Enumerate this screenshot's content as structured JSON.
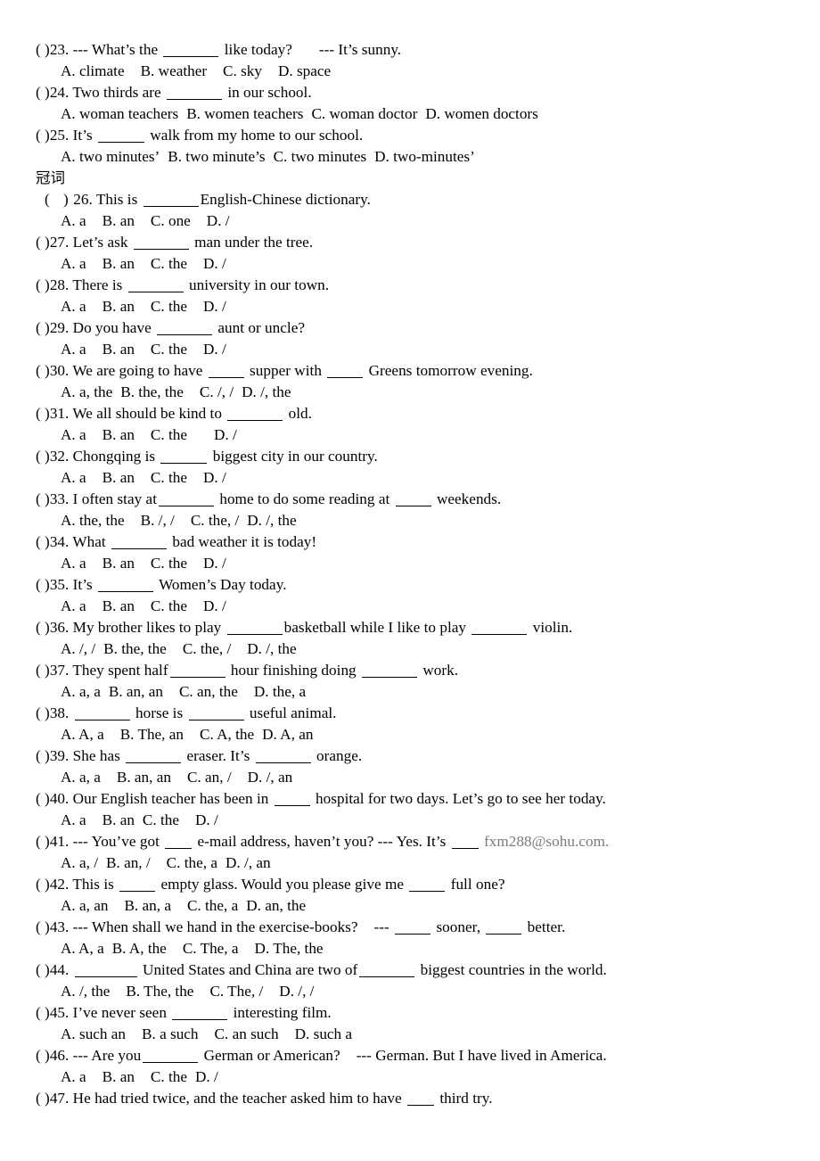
{
  "document": {
    "section_heading": "冠词",
    "questions": [
      {
        "number": "23",
        "marker": "(  )",
        "text_parts": [
          "23. --- What’s the ",
          " like today?",
          "--- It’s sunny."
        ],
        "prompt": "--- What’s the ______ like today?    --- It’s sunny.",
        "options": [
          "A. climate",
          "B. weather",
          "C. sky",
          "D. space"
        ]
      },
      {
        "number": "24",
        "marker": "(  )",
        "prompt": "24. Two thirds are ______ in our school.",
        "options": [
          "A. woman teachers",
          "B. women teachers",
          "C. woman doctor",
          "D. women doctors"
        ]
      },
      {
        "number": "25",
        "marker": "(  )",
        "prompt": "25. It’s ______ walk from my home to our school.",
        "options": [
          "A. two minutes’",
          "B. two minute’s",
          "C. two minutes",
          "D. two-minutes’"
        ]
      },
      {
        "number": "26",
        "marker": "(   )",
        "prompt": "26. This is ______ English-Chinese dictionary.",
        "options": [
          "A. a",
          "B. an",
          "C. one",
          "D. /"
        ]
      },
      {
        "number": "27",
        "marker": "(  )",
        "prompt": "27. Let’s ask ______ man under the tree.",
        "options": [
          "A. a",
          "B. an",
          "C. the",
          "D. /"
        ]
      },
      {
        "number": "28",
        "marker": "(  )",
        "prompt": "28. There is ______ university in our town.",
        "options": [
          "A. a",
          "B. an",
          "C. the",
          "D. /"
        ]
      },
      {
        "number": "29",
        "marker": "(  )",
        "prompt": "29. Do you have ______ aunt or uncle?",
        "options": [
          "A. a",
          "B. an",
          "C. the",
          "D. /"
        ]
      },
      {
        "number": "30",
        "marker": "(  )",
        "prompt": "30. We are going to have _____ supper with _____ Greens tomorrow evening.",
        "options": [
          "A. a, the",
          "B. the, the",
          "C. /, /",
          "D. /, the"
        ]
      },
      {
        "number": "31",
        "marker": "(  )",
        "prompt": "31. We all should be kind to ______ old.",
        "options": [
          "A. a",
          "B. an",
          "C. the",
          "D. /"
        ]
      },
      {
        "number": "32",
        "marker": "(  )",
        "prompt": "32. Chongqing is _____ biggest city in our country.",
        "options": [
          "A. a",
          "B. an",
          "C. the",
          "D. /"
        ]
      },
      {
        "number": "33",
        "marker": "(  )",
        "prompt": "33. I often stay at ______ home to do some reading at _____ weekends.",
        "options": [
          "A. the, the",
          "B. /, /",
          "C. the, /",
          "D. /, the"
        ]
      },
      {
        "number": "34",
        "marker": "(  )",
        "prompt": "34. What ______ bad weather it is today!",
        "options": [
          "A. a",
          "B. an",
          "C. the",
          "D. /"
        ]
      },
      {
        "number": "35",
        "marker": "(  )",
        "prompt": "35. It’s ______ Women’s Day today.",
        "options": [
          "A. a",
          "B. an",
          "C. the",
          "D. /"
        ]
      },
      {
        "number": "36",
        "marker": "(  )",
        "prompt": "36. My brother likes to play ______ basketball while I like to play ______ violin.",
        "options": [
          "A. /, /",
          "B. the, the",
          "C. the, /",
          "D. /, the"
        ]
      },
      {
        "number": "37",
        "marker": "(  )",
        "prompt": "37. They spent half ______ hour finishing doing ______ work.",
        "options": [
          "A. a, a",
          "B. an, an",
          "C. an, the",
          "D. the, a"
        ]
      },
      {
        "number": "38",
        "marker": "(  )",
        "prompt": "38. ______ horse is ______ useful animal.",
        "options": [
          "A. A, a",
          "B. The, an",
          "C. A, the",
          "D. A, an"
        ]
      },
      {
        "number": "39",
        "marker": "(  )",
        "prompt": "39. She has ______ eraser. It’s ______ orange.",
        "options": [
          "A. a, a",
          "B. an, an",
          "C. an, /",
          "D. /, an"
        ]
      },
      {
        "number": "40",
        "marker": "(  )",
        "prompt": "40. Our English teacher has been in _____ hospital for two days. Let’s go to see her today.",
        "options": [
          "A. a",
          "B. an",
          "C. the",
          "D. /"
        ]
      },
      {
        "number": "41",
        "marker": "(  )",
        "prompt": "41. --- You’ve got ___ e-mail address, haven’t you? --- Yes. It’s ___ fxm288@sohu.com.",
        "email": "fxm288@sohu.com",
        "options": [
          "A. a, /",
          "B. an, /",
          "C. the, a",
          "D. /, an"
        ]
      },
      {
        "number": "42",
        "marker": "(  )",
        "prompt": "42. This is _____ empty glass. Would you please give me _____ full one?",
        "options": [
          "A. a, an",
          "B. an, a",
          "C. the, a",
          "D. an, the"
        ]
      },
      {
        "number": "43",
        "marker": "(  )",
        "prompt": "43. --- When shall we hand in the exercise-books?  --- _____ sooner, _____ better.",
        "options": [
          "A. A, a",
          "B. A, the",
          "C. The, a",
          "D. The, the"
        ]
      },
      {
        "number": "44",
        "marker": "(  )",
        "prompt": "44. ______ United States and China are two of _____ biggest countries in the world.",
        "options": [
          "A. /, the",
          "B. The, the",
          "C. The, /",
          "D. /, /"
        ]
      },
      {
        "number": "45",
        "marker": "(  )",
        "prompt": "45. I’ve never seen ______ interesting film.",
        "options": [
          "A. such an",
          "B. a such",
          "C. an such",
          "D. such a"
        ]
      },
      {
        "number": "46",
        "marker": "(  )",
        "prompt": "46. --- Are you ______ German or American?  --- German. But I have lived in America.",
        "options": [
          "A. a",
          "B. an",
          "C. the",
          "D. /"
        ]
      },
      {
        "number": "47",
        "marker": "(  )",
        "prompt": "47. He had tried twice, and the teacher asked him to have ____ third try.",
        "options": []
      }
    ],
    "text": {
      "q23_a": "23. --- What’s the",
      "q23_b": "like today?",
      "q23_c": "--- It’s sunny.",
      "q24_a": "24. Two thirds are",
      "q24_b": "in our school.",
      "q25_a": "25. It’s",
      "q25_b": "walk from my home to our school.",
      "q26_a": "26. This is",
      "q26_b": "English-Chinese dictionary.",
      "q27_a": "27. Let’s ask",
      "q27_b": "man under the tree.",
      "q28_a": "28. There is",
      "q28_b": "university in our town.",
      "q29_a": "29. Do you have",
      "q29_b": "aunt or uncle?",
      "q30_a": "30. We are going to have",
      "q30_b": "supper with",
      "q30_c": "Greens tomorrow evening.",
      "q31_a": "31. We all should be kind to",
      "q31_b": "old.",
      "q32_a": "32. Chongqing is",
      "q32_b": "biggest city in our country.",
      "q33_a": "33. I often stay at",
      "q33_b": "home to do some reading at",
      "q33_c": "weekends.",
      "q34_a": "34. What",
      "q34_b": "bad weather it is today!",
      "q35_a": "35. It’s",
      "q35_b": "Women’s Day today.",
      "q36_a": "36. My brother likes to play",
      "q36_b": "basketball while I like to play",
      "q36_c": "violin.",
      "q37_a": "37. They spent half",
      "q37_b": "hour finishing doing",
      "q37_c": "work.",
      "q38_a": "38.",
      "q38_b": "horse is",
      "q38_c": "useful animal.",
      "q39_a": "39. She has",
      "q39_b": "eraser. It’s",
      "q39_c": "orange.",
      "q40_a": "40. Our English teacher has been in",
      "q40_b": "hospital for two days. Let’s go to see her today.",
      "q41_a": "41. --- You’ve got",
      "q41_b": "e-mail address, haven’t you? --- Yes. It’s",
      "q41_email": "fxm288@sohu.com.",
      "q42_a": "42. This is",
      "q42_b": "empty glass. Would you please give me",
      "q42_c": "full one?",
      "q43_a": "43. --- When shall we hand in the exercise-books?",
      "q43_b": "---",
      "q43_c": "sooner,",
      "q43_d": "better.",
      "q44_a": "44.",
      "q44_b": "United States and China are two of",
      "q44_c": "biggest countries in the world.",
      "q45_a": "45. I’ve never seen",
      "q45_b": "interesting film.",
      "q46_a": "46. --- Are you",
      "q46_b": "German or American?",
      "q46_c": "--- German. But I have lived in America.",
      "q47_a": "47. He had tried twice, and the teacher asked him to have",
      "q47_b": "third try."
    },
    "markers": {
      "normal": "(  )",
      "wide": "(   )"
    }
  }
}
